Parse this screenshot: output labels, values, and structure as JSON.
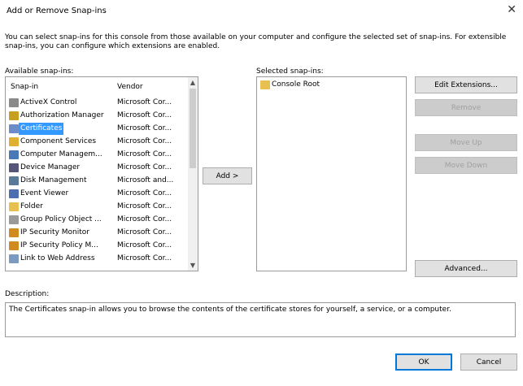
{
  "window": {
    "title": "Add or Remove Snap-ins",
    "close_glyph": "✕"
  },
  "intro": "You can select snap-ins for this console from those available on your computer and configure the selected set of snap-ins. For extensible snap-ins, you can configure which extensions are enabled.",
  "available": {
    "label": "Available snap-ins:",
    "columns": {
      "name": "Snap-in",
      "vendor": "Vendor"
    },
    "items": [
      {
        "name": "ActiveX Control",
        "vendor": "Microsoft Cor...",
        "icon": "activex-icon",
        "color": "#8a8a8a"
      },
      {
        "name": "Authorization Manager",
        "vendor": "Microsoft Cor...",
        "icon": "authorization-icon",
        "color": "#c8a020"
      },
      {
        "name": "Certificates",
        "vendor": "Microsoft Cor...",
        "icon": "certificate-icon",
        "color": "#6b8cc7",
        "selected": true
      },
      {
        "name": "Component Services",
        "vendor": "Microsoft Cor...",
        "icon": "component-icon",
        "color": "#e0b030"
      },
      {
        "name": "Computer Managem...",
        "vendor": "Microsoft Cor...",
        "icon": "computer-icon",
        "color": "#4a7ab5"
      },
      {
        "name": "Device Manager",
        "vendor": "Microsoft Cor...",
        "icon": "device-icon",
        "color": "#555577"
      },
      {
        "name": "Disk Management",
        "vendor": "Microsoft and...",
        "icon": "disk-icon",
        "color": "#5a7a9a"
      },
      {
        "name": "Event Viewer",
        "vendor": "Microsoft Cor...",
        "icon": "event-icon",
        "color": "#4d6fb0"
      },
      {
        "name": "Folder",
        "vendor": "Microsoft Cor...",
        "icon": "folder-icon",
        "color": "#e8c050"
      },
      {
        "name": "Group Policy Object ...",
        "vendor": "Microsoft Cor...",
        "icon": "policy-icon",
        "color": "#9a9a9a"
      },
      {
        "name": "IP Security Monitor",
        "vendor": "Microsoft Cor...",
        "icon": "security-icon",
        "color": "#d08a20"
      },
      {
        "name": "IP Security Policy M...",
        "vendor": "Microsoft Cor...",
        "icon": "security-policy-icon",
        "color": "#d08a20"
      },
      {
        "name": "Link to Web Address",
        "vendor": "Microsoft Cor...",
        "icon": "link-icon",
        "color": "#7a9ac0"
      }
    ]
  },
  "add_button": "Add >",
  "selected": {
    "label": "Selected snap-ins:",
    "items": [
      {
        "name": "Console Root",
        "icon": "folder-icon"
      }
    ]
  },
  "buttons": {
    "edit_extensions": "Edit Extensions...",
    "remove": "Remove",
    "move_up": "Move Up",
    "move_down": "Move Down",
    "advanced": "Advanced...",
    "ok": "OK",
    "cancel": "Cancel"
  },
  "description": {
    "label": "Description:",
    "text": "The Certificates snap-in allows you to browse the contents of the certificate stores for yourself, a service, or a computer."
  }
}
